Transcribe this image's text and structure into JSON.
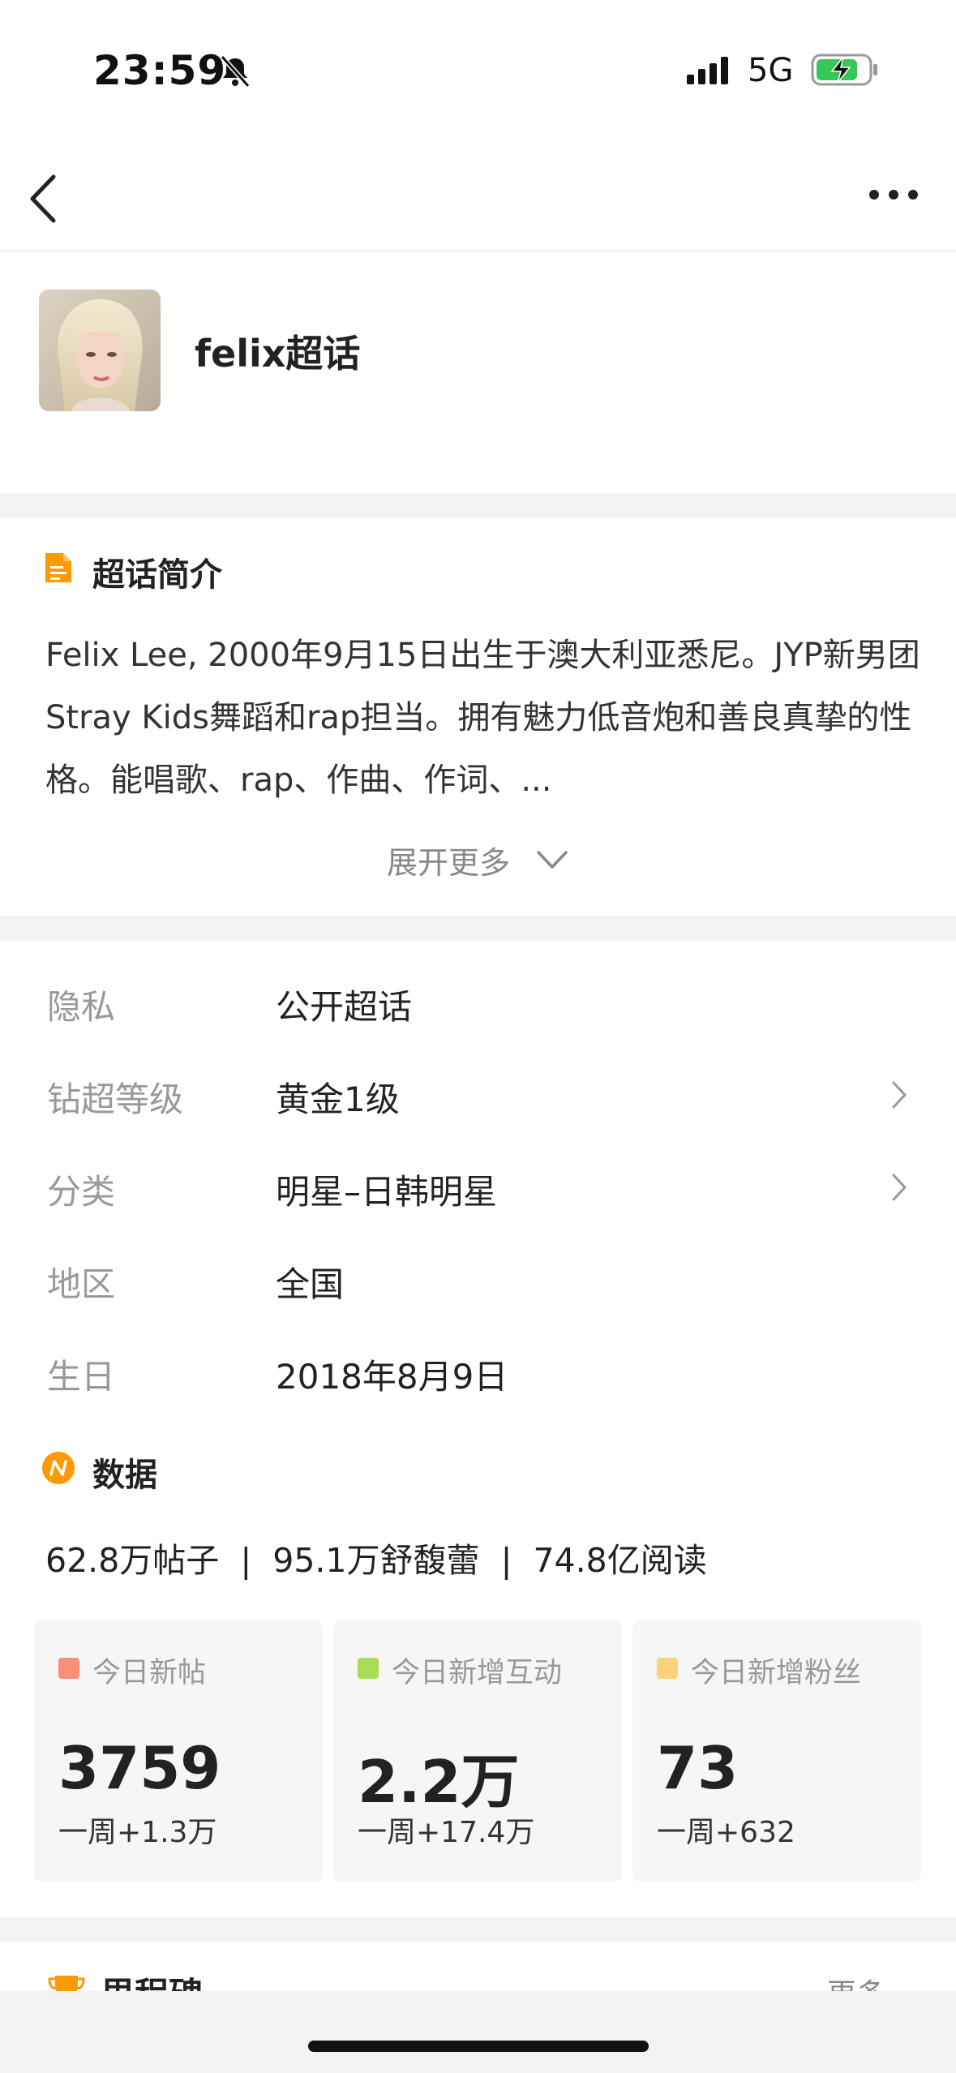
{
  "status_bar": {
    "time": "23:59",
    "network": "5G"
  },
  "header": {
    "title": "felix超话"
  },
  "intro": {
    "heading": "超话简介",
    "text": "Felix Lee, 2000年9月15日出生于澳大利亚悉尼。JYP新男团Stray Kids舞蹈和rap担当。拥有魅力低音炮和善良真挚的性格。能唱歌、rap、作曲、作词、...",
    "expand_label": "展开更多"
  },
  "info_rows": [
    {
      "label": "隐私",
      "value": "公开超话"
    },
    {
      "label": "钻超等级",
      "value": "黄金1级"
    },
    {
      "label": "分类",
      "value": "明星–日韩明星"
    },
    {
      "label": "地区",
      "value": "全国"
    },
    {
      "label": "生日",
      "value": "2018年8月9日"
    }
  ],
  "data_section": {
    "heading": "数据",
    "summary": "62.8万帖子  |  95.1万舒馥蕾  |  74.8亿阅读",
    "cards": [
      {
        "label": "今日新帖",
        "value": "3759",
        "week": "一周+1.3万",
        "color": "#f79077"
      },
      {
        "label": "今日新增互动",
        "value": "2.2万",
        "week": "一周+17.4万",
        "color": "#a8dd55"
      },
      {
        "label": "今日新增粉丝",
        "value": "73",
        "week": "一周+632",
        "color": "#ffd27a"
      }
    ]
  },
  "milestone": {
    "heading": "里程碑",
    "more_label": "更多"
  },
  "colors": {
    "accent": "#ff9900",
    "gap": "#f2f2f2"
  }
}
